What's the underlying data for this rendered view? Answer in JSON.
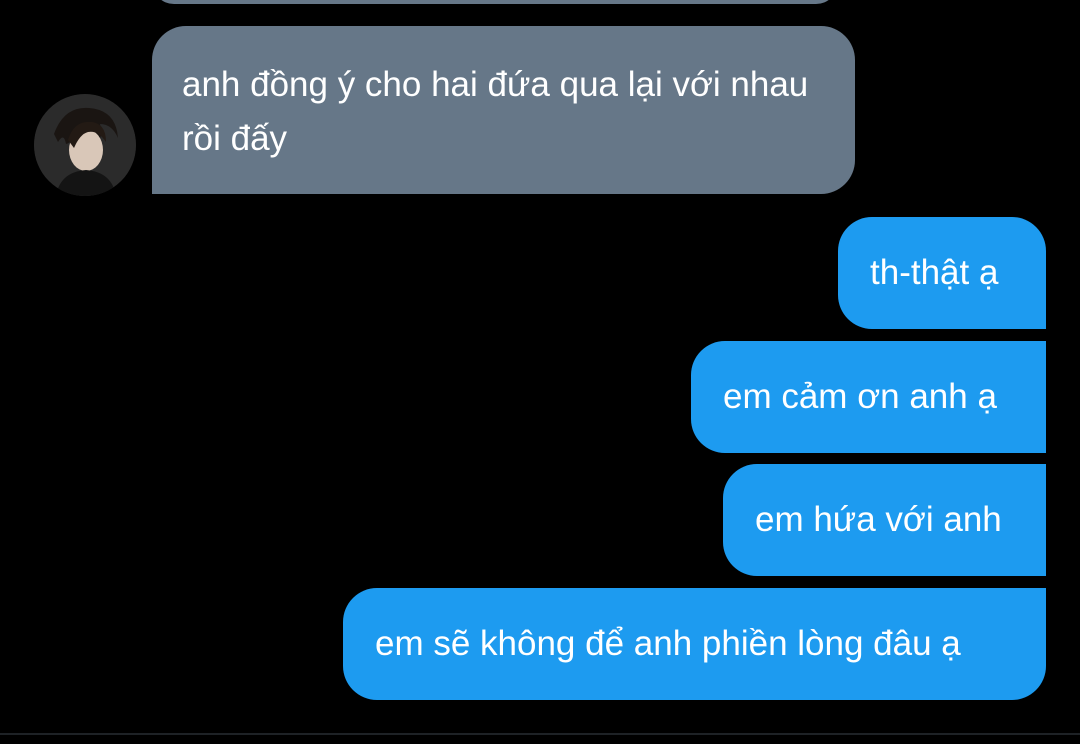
{
  "conversation": {
    "incoming": [
      {
        "text": "anh đồng ý cho hai đứa qua lại với nhau rồi đấy",
        "avatar_icon": "user-avatar-photo"
      }
    ],
    "outgoing": [
      {
        "text": "th-thật ạ"
      },
      {
        "text": "em cảm ơn anh ạ"
      },
      {
        "text": "em hứa với anh"
      },
      {
        "text": "em sẽ không để anh phiền lòng đâu ạ"
      }
    ]
  },
  "colors": {
    "background": "#000000",
    "incoming_bubble": "#667788",
    "outgoing_bubble": "#1d9bf0",
    "text": "#ffffff"
  }
}
